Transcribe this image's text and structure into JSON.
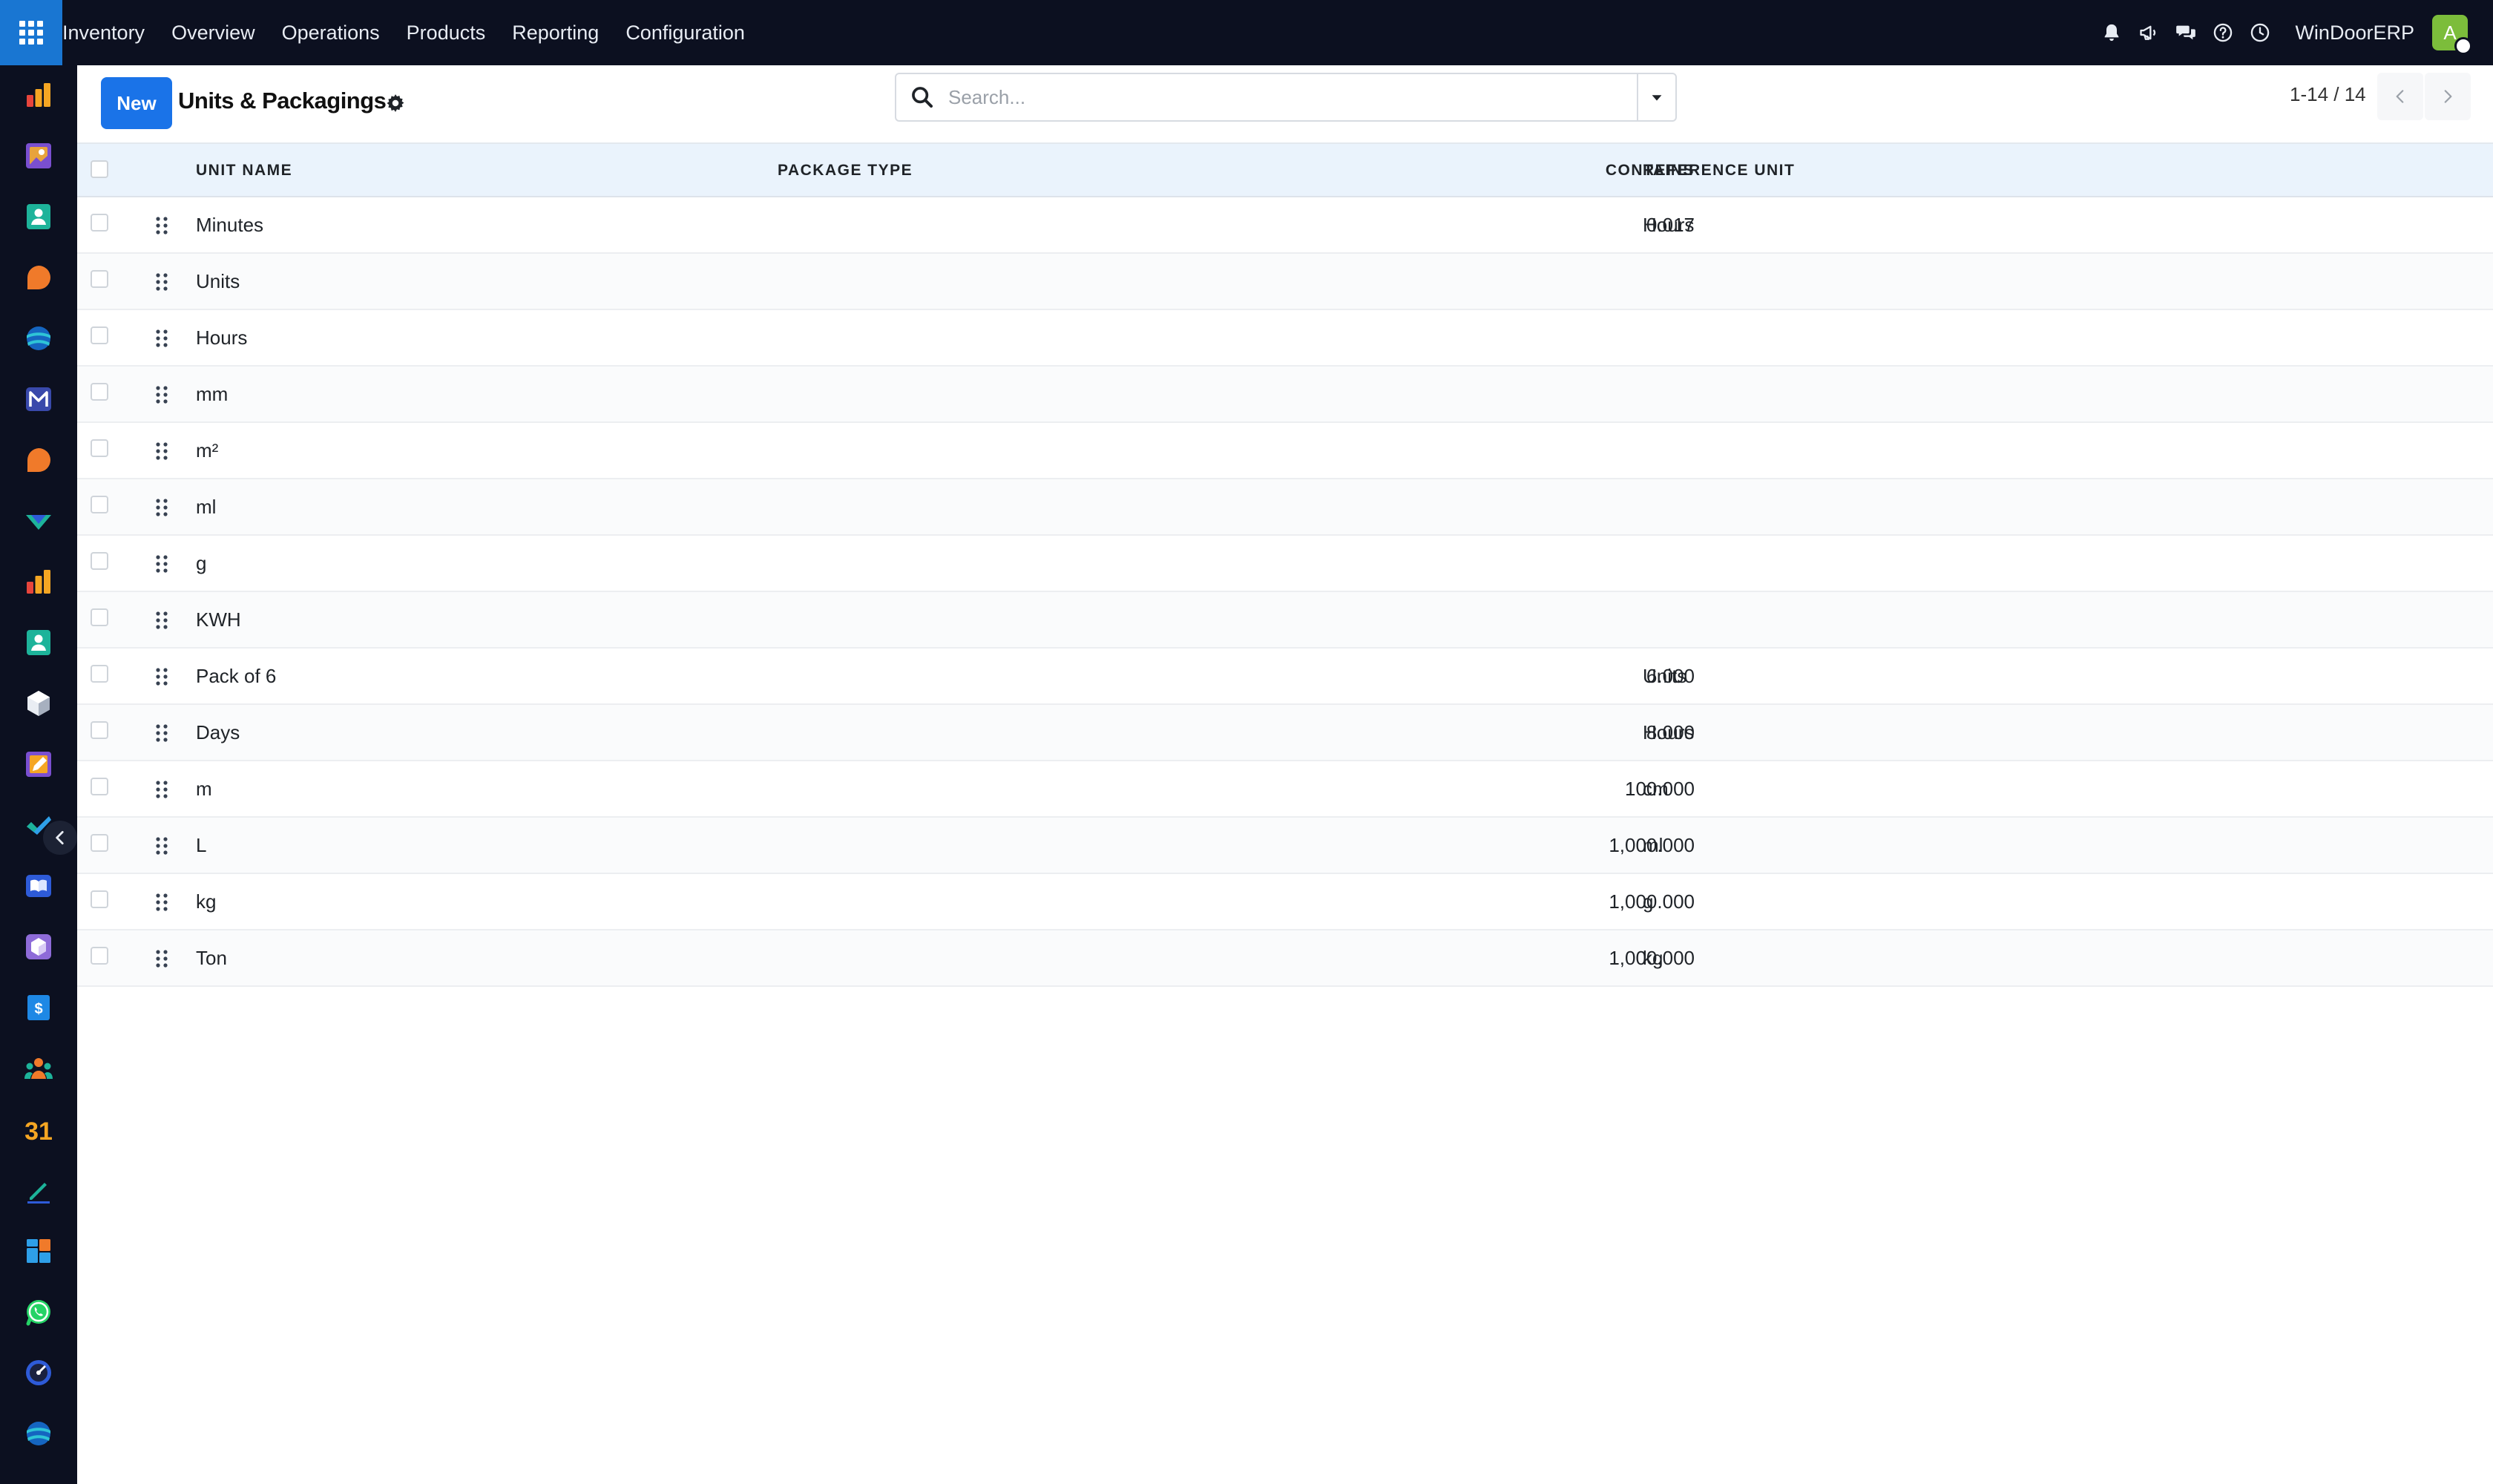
{
  "navbar": {
    "menu": [
      "Inventory",
      "Overview",
      "Operations",
      "Products",
      "Reporting",
      "Configuration"
    ],
    "company": "WinDoorERP",
    "avatar_initial": "A"
  },
  "control_panel": {
    "new_label": "New",
    "breadcrumb": "Units & Packagings",
    "search_placeholder": "Search...",
    "pager": "1-14 / 14"
  },
  "table": {
    "columns": {
      "unit_name": "UNIT NAME",
      "package_type": "PACKAGE TYPE",
      "contains": "CONTAINS",
      "reference_unit": "REFERENCE UNIT"
    },
    "rows": [
      {
        "name": "Minutes",
        "package_type": "",
        "contains": "0.017",
        "reference": "Hours"
      },
      {
        "name": "Units",
        "package_type": "",
        "contains": "",
        "reference": ""
      },
      {
        "name": "Hours",
        "package_type": "",
        "contains": "",
        "reference": ""
      },
      {
        "name": "mm",
        "package_type": "",
        "contains": "",
        "reference": ""
      },
      {
        "name": "m²",
        "package_type": "",
        "contains": "",
        "reference": ""
      },
      {
        "name": "ml",
        "package_type": "",
        "contains": "",
        "reference": ""
      },
      {
        "name": "g",
        "package_type": "",
        "contains": "",
        "reference": ""
      },
      {
        "name": "KWH",
        "package_type": "",
        "contains": "",
        "reference": ""
      },
      {
        "name": "Pack of 6",
        "package_type": "",
        "contains": "6.000",
        "reference": "Units"
      },
      {
        "name": "Days",
        "package_type": "",
        "contains": "8.000",
        "reference": "Hours"
      },
      {
        "name": "m",
        "package_type": "",
        "contains": "100.000",
        "reference": "cm"
      },
      {
        "name": "L",
        "package_type": "",
        "contains": "1,000.000",
        "reference": "ml"
      },
      {
        "name": "kg",
        "package_type": "",
        "contains": "1,000.000",
        "reference": "g"
      },
      {
        "name": "Ton",
        "package_type": "",
        "contains": "1,000.000",
        "reference": "kg"
      }
    ]
  },
  "sidebar_apps": [
    {
      "icon": "dashboard-bars-icon",
      "colors": [
        "#f5a623",
        "#e8453c"
      ]
    },
    {
      "icon": "frame-icon",
      "colors": [
        "#e8a33c",
        "#7a4fd0"
      ]
    },
    {
      "icon": "contacts-icon",
      "colors": [
        "#1db39a",
        "#ffffff"
      ]
    },
    {
      "icon": "chat-bubble-icon",
      "colors": [
        "#f07a2a",
        "#f07a2a"
      ]
    },
    {
      "icon": "sphere-icon",
      "colors": [
        "#2ec4d6",
        "#1565c0"
      ]
    },
    {
      "icon": "mail-icon",
      "colors": [
        "#3949ab",
        "#ffffff"
      ]
    },
    {
      "icon": "chat-bubble-icon",
      "colors": [
        "#f07a2a",
        "#f07a2a"
      ]
    },
    {
      "icon": "shield-check-icon",
      "colors": [
        "#1db39a",
        "#2e5bd8"
      ]
    },
    {
      "icon": "dashboard-bars-icon",
      "colors": [
        "#f5a623",
        "#e8453c"
      ]
    },
    {
      "icon": "contacts-icon",
      "colors": [
        "#1db39a",
        "#ffffff"
      ]
    },
    {
      "icon": "cube-icon",
      "colors": [
        "#e9edf3",
        "#a7b0bf"
      ]
    },
    {
      "icon": "pencil-icon",
      "colors": [
        "#f5a623",
        "#7a4fd0"
      ]
    },
    {
      "icon": "checkmark-icon",
      "colors": [
        "#1db39a",
        "#2e9fe8"
      ]
    },
    {
      "icon": "book-icon",
      "colors": [
        "#2e5bd8",
        "#ffffff"
      ]
    },
    {
      "icon": "package-box-icon",
      "colors": [
        "#8e6bd8",
        "#ffffff"
      ]
    },
    {
      "icon": "invoice-icon",
      "colors": [
        "#1e88e5",
        "#ffffff"
      ]
    },
    {
      "icon": "team-icon",
      "colors": [
        "#f07a2a",
        "#1db39a"
      ]
    },
    {
      "icon": "calendar-icon",
      "colors": [
        "#f5a623",
        "#e8453c"
      ]
    },
    {
      "icon": "signature-icon",
      "colors": [
        "#1db39a",
        "#2e5bd8"
      ]
    },
    {
      "icon": "dashboard-tiles-icon",
      "colors": [
        "#2e9fe8",
        "#f07a2a"
      ]
    },
    {
      "icon": "whatsapp-icon",
      "colors": [
        "#25d366",
        "#ffffff"
      ]
    },
    {
      "icon": "speedometer-icon",
      "colors": [
        "#2e5bd8",
        "#ffffff"
      ]
    },
    {
      "icon": "sphere-icon",
      "colors": [
        "#2ec4d6",
        "#1565c0"
      ]
    }
  ],
  "theme": {
    "accent": "#1a73e8",
    "navbar_bg": "#0c1020",
    "header_bg": "#eaf3fc"
  }
}
